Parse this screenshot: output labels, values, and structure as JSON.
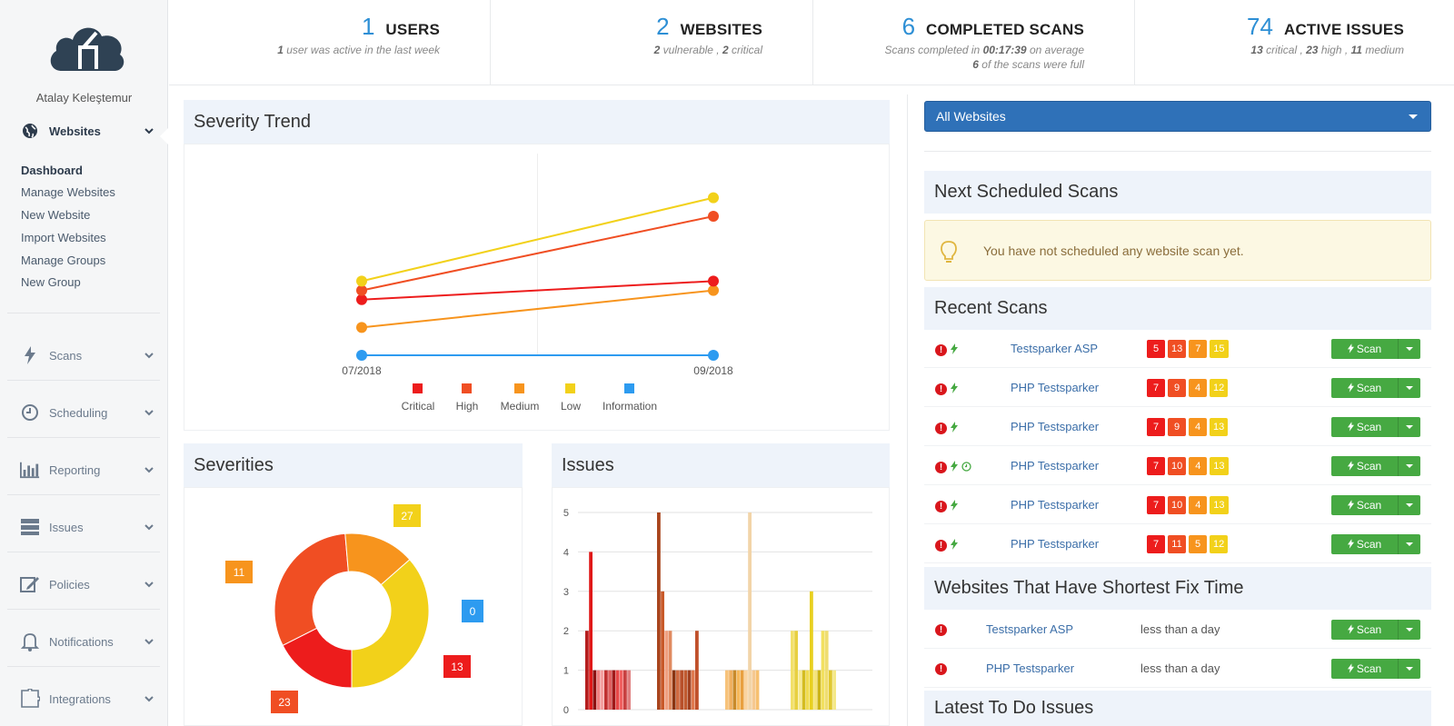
{
  "user": {
    "name": "Atalay Keleştemur"
  },
  "nav": {
    "websites": "Websites",
    "scans": "Scans",
    "scheduling": "Scheduling",
    "reporting": "Reporting",
    "issues": "Issues",
    "policies": "Policies",
    "notifications": "Notifications",
    "integrations": "Integrations",
    "sub": [
      "Dashboard",
      "Manage Websites",
      "New Website",
      "Import Websites",
      "Manage Groups",
      "New Group"
    ]
  },
  "stats": {
    "users": {
      "num": "1",
      "title": "USERS",
      "sub_b": "1",
      "sub": " user was active in the last week"
    },
    "websites": {
      "num": "2",
      "title": "WEBSITES",
      "sub_b1": "2",
      "sub1": " vulnerable , ",
      "sub_b2": "2",
      "sub2": " critical"
    },
    "scans": {
      "num": "6",
      "title": "COMPLETED SCANS",
      "sub1a": "Scans completed in ",
      "sub1b": "00:17:39",
      "sub1c": " on average",
      "sub2b": "6",
      "sub2": " of the scans were full"
    },
    "issues": {
      "num": "74",
      "title": "ACTIVE ISSUES",
      "b1": "13",
      "t1": " critical , ",
      "b2": "23",
      "t2": " high , ",
      "b3": "11",
      "t3": " medium"
    }
  },
  "panels": {
    "trend": "Severity Trend",
    "severities": "Severities",
    "issues": "Issues",
    "next": "Next Scheduled Scans",
    "recent": "Recent Scans",
    "shortest": "Websites That Have Shortest Fix Time",
    "todo": "Latest To Do Issues"
  },
  "select": {
    "value": "All Websites"
  },
  "alert": {
    "text": "You have not scheduled any website scan yet."
  },
  "scan_label": "Scan",
  "recent_scans": [
    {
      "site": "Testsparker ASP",
      "c": "5",
      "h": "13",
      "m": "7",
      "l": "15",
      "clock": false
    },
    {
      "site": "PHP Testsparker",
      "c": "7",
      "h": "9",
      "m": "4",
      "l": "12",
      "clock": false
    },
    {
      "site": "PHP Testsparker",
      "c": "7",
      "h": "9",
      "m": "4",
      "l": "13",
      "clock": false
    },
    {
      "site": "PHP Testsparker",
      "c": "7",
      "h": "10",
      "m": "4",
      "l": "13",
      "clock": true
    },
    {
      "site": "PHP Testsparker",
      "c": "7",
      "h": "10",
      "m": "4",
      "l": "13",
      "clock": false
    },
    {
      "site": "PHP Testsparker",
      "c": "7",
      "h": "11",
      "m": "5",
      "l": "12",
      "clock": false
    }
  ],
  "shortest": [
    {
      "site": "Testsparker ASP",
      "time": "less than a day"
    },
    {
      "site": "PHP Testsparker",
      "time": "less than a day"
    }
  ],
  "colors": {
    "critical": "#ed1c1c",
    "high": "#f04e23",
    "medium": "#f7941d",
    "low": "#f2d11a",
    "info": "#2d9bf0"
  },
  "chart_data": [
    {
      "type": "line",
      "title": "Severity Trend",
      "x": [
        "07/2018",
        "09/2018"
      ],
      "series": [
        {
          "name": "Critical",
          "values": [
            6,
            8
          ]
        },
        {
          "name": "High",
          "values": [
            7,
            15
          ]
        },
        {
          "name": "Medium",
          "values": [
            3,
            7
          ]
        },
        {
          "name": "Low",
          "values": [
            8,
            17
          ]
        },
        {
          "name": "Information",
          "values": [
            0,
            0
          ]
        }
      ],
      "ylim": [
        0,
        20
      ]
    },
    {
      "type": "pie",
      "title": "Severities",
      "labels": [
        "Critical",
        "High",
        "Medium",
        "Low",
        "Information"
      ],
      "values": [
        13,
        23,
        11,
        27,
        0
      ]
    },
    {
      "type": "bar",
      "title": "Issues",
      "ylim": [
        0,
        5
      ],
      "yticks": [
        0,
        1,
        2,
        3,
        4,
        5
      ],
      "groups": [
        {
          "values": [
            2,
            4,
            1,
            1,
            1,
            1,
            1,
            1,
            1,
            1,
            1,
            1
          ],
          "colors": [
            "#b51d1d",
            "#e01818",
            "#8b1111",
            "#f08080",
            "#f4a0a0",
            "#c03030",
            "#e06060",
            "#a01818",
            "#e84848",
            "#f06060",
            "#c84040",
            "#e08080"
          ]
        },
        {
          "values": [
            5,
            3,
            2,
            2,
            1,
            1,
            1,
            1,
            1,
            1,
            2
          ],
          "colors": [
            "#a9441c",
            "#c85a2a",
            "#f0a080",
            "#e08a60",
            "#8a3410",
            "#d06a40",
            "#b8502a",
            "#c05a30",
            "#a04020",
            "#e07a50",
            "#c0502a"
          ]
        },
        {
          "values": [
            1,
            1,
            1,
            1,
            1,
            1,
            5,
            1,
            1
          ],
          "colors": [
            "#f7c27a",
            "#f0b060",
            "#c88a2a",
            "#f6b85a",
            "#e8a040",
            "#fad4a0",
            "#f2d4a8",
            "#f5c890",
            "#f7c070"
          ]
        },
        {
          "values": [
            2,
            2,
            1,
            1,
            1,
            3,
            1,
            1,
            2,
            2,
            1,
            1
          ],
          "colors": [
            "#f2e06a",
            "#e8d040",
            "#f7ea90",
            "#d4bc20",
            "#f0dc50",
            "#e8d020",
            "#f5e47a",
            "#ccb418",
            "#f2e060",
            "#efdd70",
            "#e0c830",
            "#f4e888"
          ]
        }
      ]
    }
  ]
}
